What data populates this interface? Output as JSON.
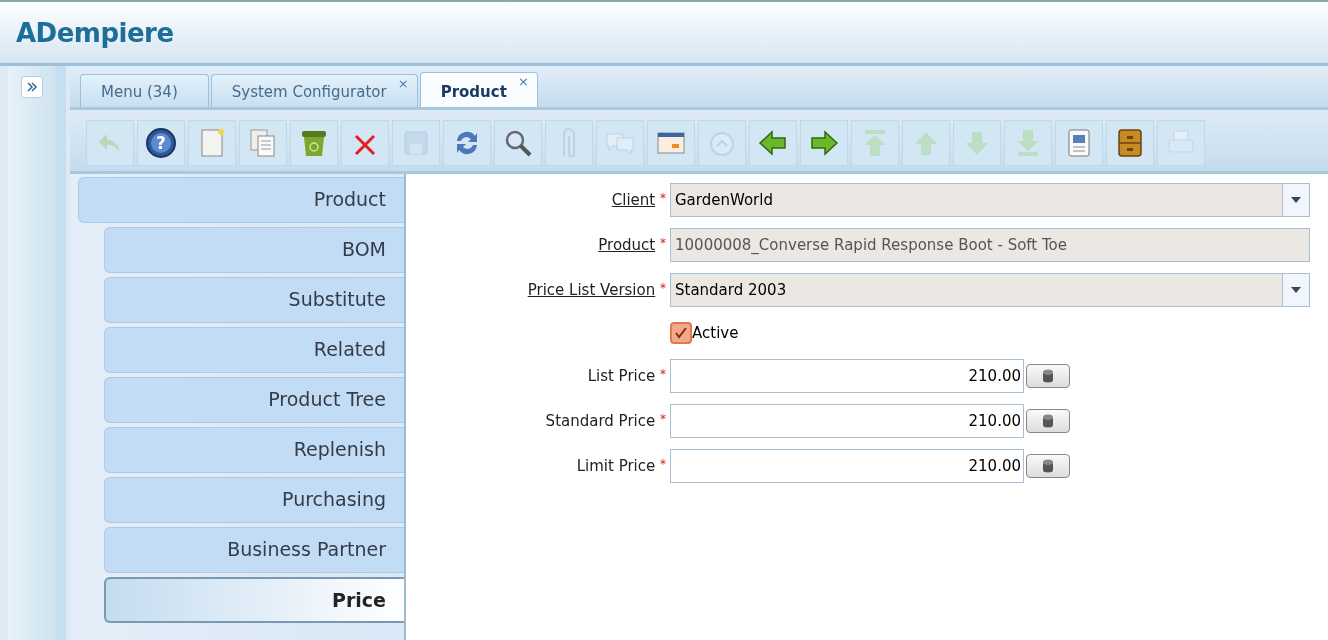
{
  "app": {
    "logo": "ADempiere"
  },
  "tabs": [
    {
      "label": "Menu (34)",
      "selected": false,
      "closable": false
    },
    {
      "label": "System Configurator",
      "selected": false,
      "closable": true
    },
    {
      "label": "Product",
      "selected": true,
      "closable": true
    }
  ],
  "close_mark": "×",
  "toolbar": [
    {
      "kind": "undo",
      "disabled": true
    },
    {
      "kind": "help",
      "disabled": false,
      "glyph": "?"
    },
    {
      "kind": "new",
      "disabled": false
    },
    {
      "kind": "copy",
      "disabled": false
    },
    {
      "kind": "delete",
      "disabled": false
    },
    {
      "kind": "delete-selection",
      "disabled": false
    },
    {
      "kind": "save",
      "disabled": true
    },
    {
      "kind": "refresh",
      "disabled": false
    },
    {
      "kind": "search",
      "disabled": false
    },
    {
      "kind": "attachment",
      "disabled": true
    },
    {
      "kind": "chat",
      "disabled": true
    },
    {
      "kind": "grid",
      "disabled": false
    },
    {
      "kind": "history",
      "disabled": true
    },
    {
      "kind": "previous",
      "disabled": false
    },
    {
      "kind": "next",
      "disabled": false
    },
    {
      "kind": "first",
      "disabled": true
    },
    {
      "kind": "up",
      "disabled": true
    },
    {
      "kind": "down",
      "disabled": true
    },
    {
      "kind": "last",
      "disabled": true
    },
    {
      "kind": "report",
      "disabled": false
    },
    {
      "kind": "archive",
      "disabled": false
    },
    {
      "kind": "print",
      "disabled": true
    }
  ],
  "side_tabs": [
    {
      "label": "Product",
      "selected": false,
      "children": [
        {
          "label": "BOM",
          "selected": false
        },
        {
          "label": "Substitute",
          "selected": false
        },
        {
          "label": "Related",
          "selected": false
        },
        {
          "label": "Product Tree",
          "selected": false
        },
        {
          "label": "Replenish",
          "selected": false
        },
        {
          "label": "Purchasing",
          "selected": false
        },
        {
          "label": "Business Partner",
          "selected": false
        },
        {
          "label": "Price",
          "selected": true
        }
      ]
    }
  ],
  "required_mark": "*",
  "fields": [
    {
      "kind": "combo",
      "label": "Client",
      "required": true,
      "zoomable": true,
      "value": "GardenWorld"
    },
    {
      "kind": "text",
      "label": "Product",
      "required": true,
      "zoomable": true,
      "value": "10000008_Converse Rapid Response Boot - Soft Toe",
      "readonly": true
    },
    {
      "kind": "combo",
      "label": "Price List Version",
      "required": true,
      "zoomable": true,
      "value": "Standard 2003"
    },
    {
      "kind": "checkbox",
      "label": "Active",
      "checked": true
    },
    {
      "kind": "number",
      "label": "List Price",
      "required": true,
      "zoomable": false,
      "value": "210.00"
    },
    {
      "kind": "number",
      "label": "Standard Price",
      "required": true,
      "zoomable": false,
      "value": "210.00"
    },
    {
      "kind": "number",
      "label": "Limit Price",
      "required": true,
      "zoomable": false,
      "value": "210.00"
    }
  ]
}
